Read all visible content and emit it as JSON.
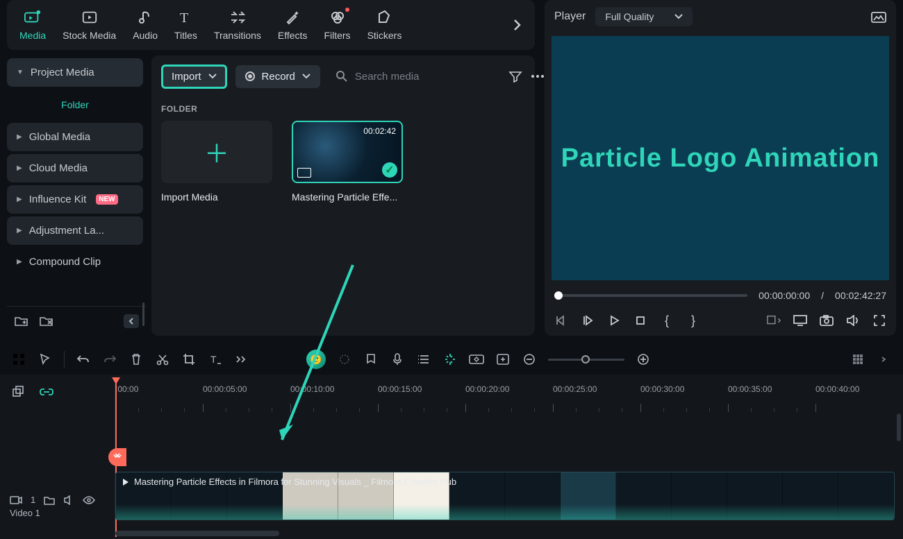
{
  "tabs": [
    {
      "label": "Media",
      "icon": "media"
    },
    {
      "label": "Stock Media",
      "icon": "stock"
    },
    {
      "label": "Audio",
      "icon": "audio"
    },
    {
      "label": "Titles",
      "icon": "titles"
    },
    {
      "label": "Transitions",
      "icon": "transitions"
    },
    {
      "label": "Effects",
      "icon": "effects"
    },
    {
      "label": "Filters",
      "icon": "filters"
    },
    {
      "label": "Stickers",
      "icon": "stickers"
    }
  ],
  "sidebar": {
    "project_media": "Project Media",
    "folder_label": "Folder",
    "items": [
      {
        "label": "Global Media"
      },
      {
        "label": "Cloud Media"
      },
      {
        "label": "Influence Kit",
        "badge": "NEW"
      },
      {
        "label": "Adjustment La..."
      },
      {
        "label": "Compound Clip"
      }
    ]
  },
  "browser": {
    "import_label": "Import",
    "record_label": "Record",
    "search_placeholder": "Search media",
    "section": "FOLDER",
    "import_caption": "Import Media",
    "clip_duration": "00:02:42",
    "clip_caption": "Mastering Particle Effe..."
  },
  "player": {
    "label": "Player",
    "quality": "Full Quality",
    "preview_text": "Particle Logo Animation",
    "current": "00:00:00:00",
    "sep": "/",
    "total": "00:02:42:27"
  },
  "ruler": [
    ":00:00",
    "00:00:05:00",
    "00:00:10:00",
    "00:00:15:00",
    "00:00:20:00",
    "00:00:25:00",
    "00:00:30:00",
    "00:00:35:00",
    "00:00:40:00"
  ],
  "track": {
    "cam_count": "1",
    "name": "Video 1",
    "clip_title": "Mastering Particle Effects in Filmora for Stunning Visuals _ Filmora       Creative Hub"
  }
}
